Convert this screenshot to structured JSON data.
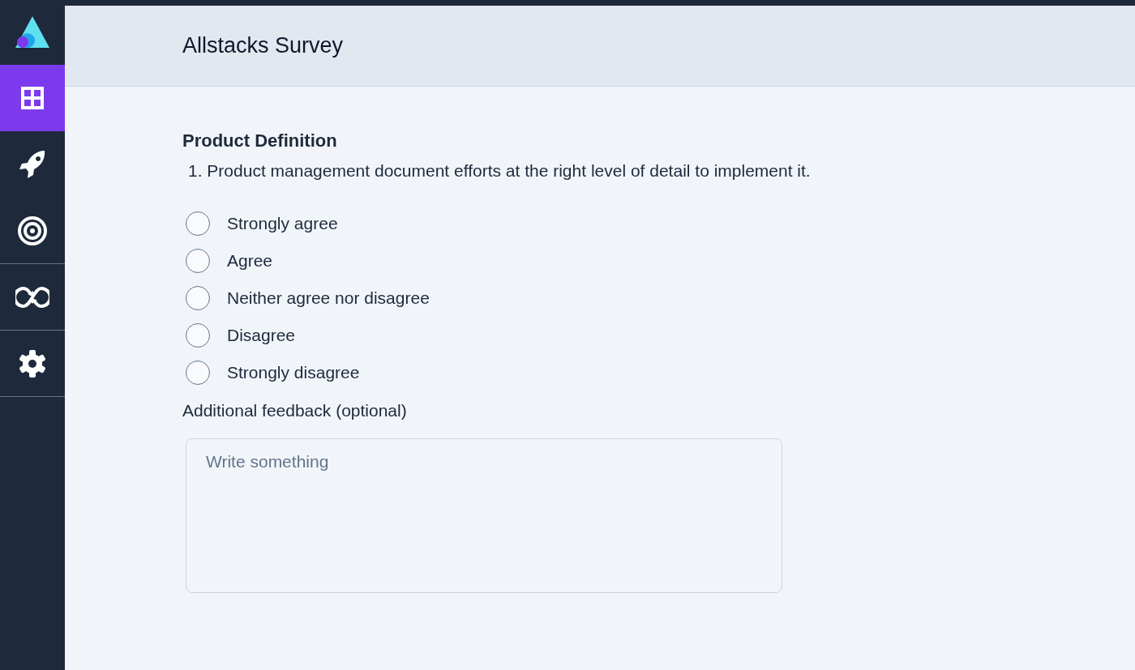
{
  "sidebar": {
    "items": [
      {
        "kind": "grid",
        "selected": true
      },
      {
        "kind": "rocket",
        "selected": false
      },
      {
        "kind": "target",
        "selected": false
      },
      {
        "kind": "loop",
        "selected": false
      },
      {
        "kind": "gear",
        "selected": false
      }
    ]
  },
  "header": {
    "title": "Allstacks Survey"
  },
  "section": {
    "title": "Product Definition",
    "question": "1. Product management document efforts at the right level of detail to implement it.",
    "options": [
      {
        "label": "Strongly agree",
        "selected": false
      },
      {
        "label": "Agree",
        "selected": false
      },
      {
        "label": "Neither agree nor disagree",
        "selected": false
      },
      {
        "label": "Disagree",
        "selected": false
      },
      {
        "label": "Strongly disagree",
        "selected": false
      }
    ],
    "feedback": {
      "label": "Additional feedback (optional)",
      "placeholder": "Write something"
    }
  }
}
